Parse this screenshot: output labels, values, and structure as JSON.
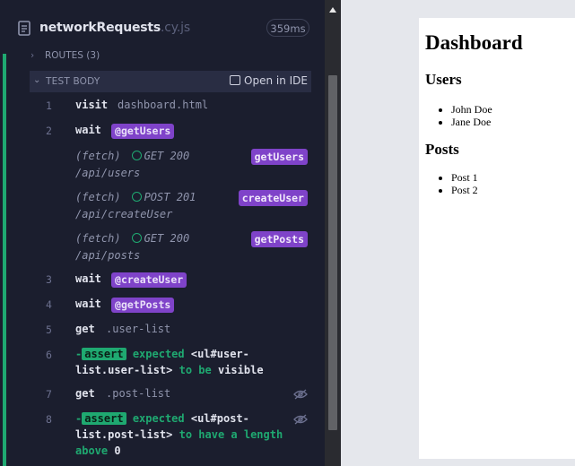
{
  "spec": {
    "name": "networkRequests",
    "ext": ".cy.js",
    "duration": "359ms"
  },
  "routes": {
    "label": "ROUTES (3)"
  },
  "test_body": {
    "label": "TEST BODY",
    "open_ide": "Open in IDE"
  },
  "commands": [
    {
      "num": "1",
      "name": "visit",
      "message": "dashboard.html"
    },
    {
      "num": "2",
      "name": "wait",
      "alias": "getUsers"
    },
    {
      "num": "3",
      "name": "wait",
      "alias": "createUser"
    },
    {
      "num": "4",
      "name": "wait",
      "alias": "getPosts"
    },
    {
      "num": "5",
      "name": "get",
      "message": ".user-list"
    },
    {
      "num": "6",
      "dash": "-",
      "badge": "assert",
      "line1a": "expected",
      "line1b": "<ul#user-",
      "line2a": "list.user-list>",
      "line2b": "to be",
      "line2c": "visible"
    },
    {
      "num": "7",
      "name": "get",
      "message": ".post-list"
    },
    {
      "num": "8",
      "dash": "-",
      "badge": "assert",
      "line1a": "expected",
      "line1b": "<ul#post-",
      "line2a": "list.post-list>",
      "line2b": "to have a length",
      "line3a": "above",
      "line3b": "0"
    }
  ],
  "requests": [
    {
      "type": "(fetch)",
      "method": "GET",
      "status": "200",
      "url": "/api/users",
      "alias": "getUsers"
    },
    {
      "type": "(fetch)",
      "method": "POST",
      "status": "201",
      "url": "/api/createUser",
      "alias": "createUser"
    },
    {
      "type": "(fetch)",
      "method": "GET",
      "status": "200",
      "url": "/api/posts",
      "alias": "getPosts"
    }
  ],
  "app": {
    "title": "Dashboard",
    "users_heading": "Users",
    "users": [
      "John Doe",
      "Jane Doe"
    ],
    "posts_heading": "Posts",
    "posts": [
      "Post 1",
      "Post 2"
    ]
  },
  "colors": {
    "accent_green": "#1fa971",
    "alias_purple": "#7f43c9",
    "panel_bg": "#1b1e2e"
  },
  "icons": [
    "spec-file-icon",
    "chevron-right-icon",
    "chevron-down-icon",
    "open-in-ide-icon",
    "success-circle-icon",
    "eye-hidden-icon"
  ]
}
